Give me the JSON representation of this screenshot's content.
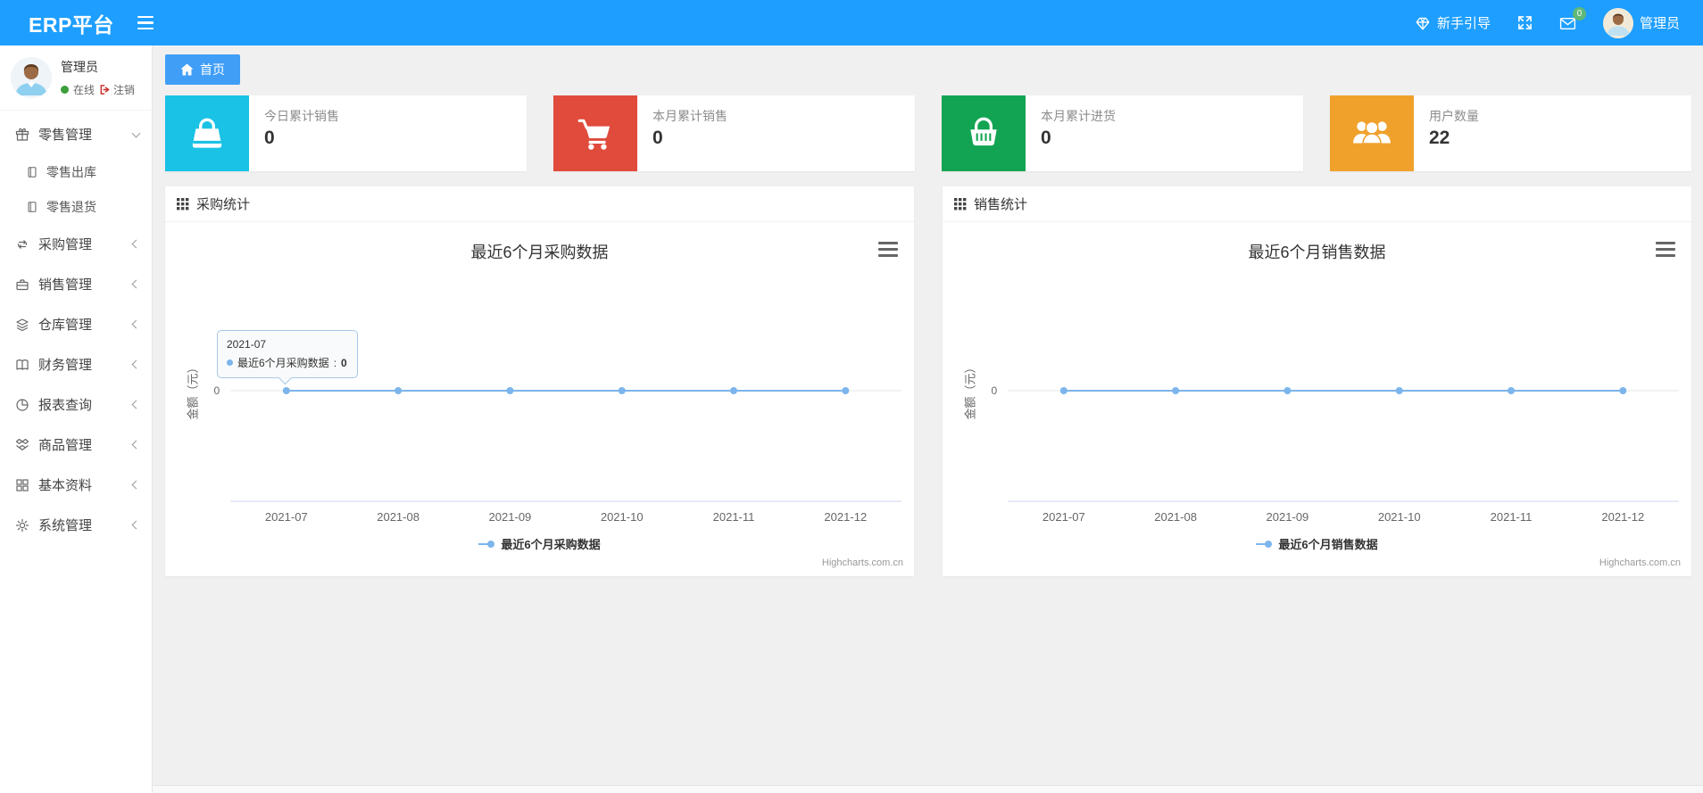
{
  "navbar": {
    "brand": "ERP平台",
    "guide": "新手引导",
    "mail_badge": "0",
    "username": "管理员"
  },
  "sidebar": {
    "user": {
      "name": "管理员",
      "status": "在线",
      "logout": "注销"
    },
    "menu": [
      {
        "label": "零售管理",
        "icon": "gift-icon",
        "expanded": true,
        "children": [
          {
            "label": "零售出库",
            "icon": "notebook-icon"
          },
          {
            "label": "零售退货",
            "icon": "notebook-icon"
          }
        ]
      },
      {
        "label": "采购管理",
        "icon": "purchase-loop-icon"
      },
      {
        "label": "销售管理",
        "icon": "briefcase-icon"
      },
      {
        "label": "仓库管理",
        "icon": "layers-icon"
      },
      {
        "label": "财务管理",
        "icon": "ledger-icon"
      },
      {
        "label": "报表查询",
        "icon": "pie-chart-icon"
      },
      {
        "label": "商品管理",
        "icon": "box-icon"
      },
      {
        "label": "基本资料",
        "icon": "grid-icon"
      },
      {
        "label": "系统管理",
        "icon": "gear-icon"
      }
    ]
  },
  "tabs": {
    "home": "首页"
  },
  "stats": [
    {
      "label": "今日累计销售",
      "value": "0",
      "color": "#1ac2e6",
      "icon": "shopping-bag-icon"
    },
    {
      "label": "本月累计销售",
      "value": "0",
      "color": "#e04b3c",
      "icon": "shopping-cart-icon"
    },
    {
      "label": "本月累计进货",
      "value": "0",
      "color": "#12a452",
      "icon": "shopping-basket-icon"
    },
    {
      "label": "用户数量",
      "value": "22",
      "color": "#f0a12c",
      "icon": "users-icon"
    }
  ],
  "panels": [
    {
      "title": "采购统计"
    },
    {
      "title": "销售统计"
    }
  ],
  "chart_data": [
    {
      "type": "line",
      "title": "最近6个月采购数据",
      "categories": [
        "2021-07",
        "2021-08",
        "2021-09",
        "2021-10",
        "2021-11",
        "2021-12"
      ],
      "series": [
        {
          "name": "最近6个月采购数据",
          "values": [
            0,
            0,
            0,
            0,
            0,
            0
          ]
        }
      ],
      "xlabel": "",
      "ylabel": "金额（元）",
      "yticks": [
        "0"
      ],
      "ylim": [
        0,
        1
      ],
      "grid": true,
      "legend_position": "bottom",
      "line_color": "#7cb5ec",
      "credit": "Highcharts.com.cn",
      "tooltip": {
        "title": "2021-07",
        "series_name": "最近6个月采购数据",
        "separator": ": ",
        "value": "0",
        "point_index": 0
      }
    },
    {
      "type": "line",
      "title": "最近6个月销售数据",
      "categories": [
        "2021-07",
        "2021-08",
        "2021-09",
        "2021-10",
        "2021-11",
        "2021-12"
      ],
      "series": [
        {
          "name": "最近6个月销售数据",
          "values": [
            0,
            0,
            0,
            0,
            0,
            0
          ]
        }
      ],
      "xlabel": "",
      "ylabel": "金额（元）",
      "yticks": [
        "0"
      ],
      "ylim": [
        0,
        1
      ],
      "grid": true,
      "legend_position": "bottom",
      "line_color": "#7cb5ec",
      "credit": "Highcharts.com.cn"
    }
  ]
}
